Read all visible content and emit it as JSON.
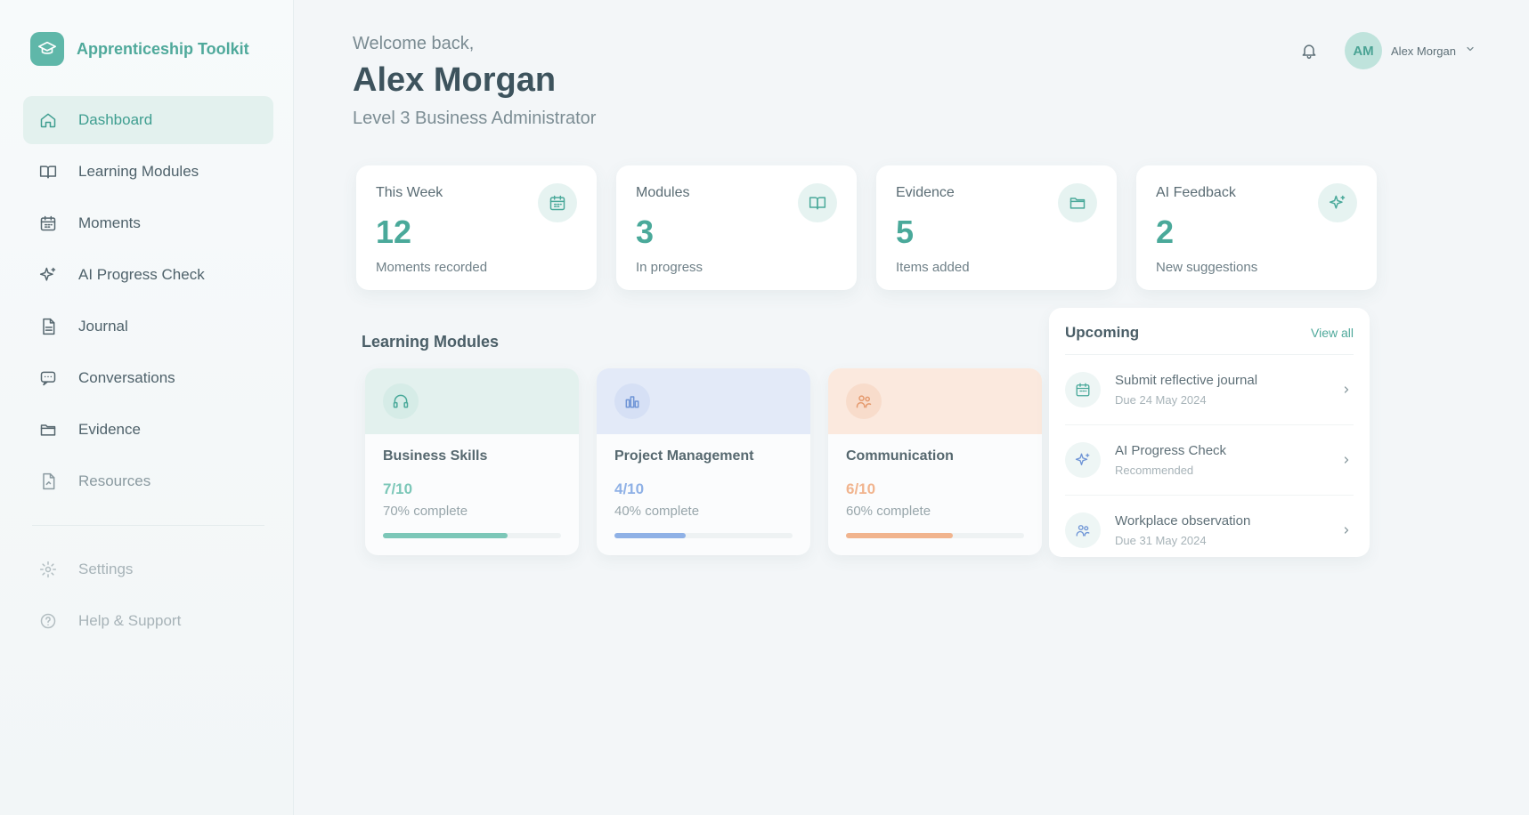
{
  "app": {
    "name": "Apprenticeship Toolkit",
    "accent": "#5fb7a9"
  },
  "sidebar": {
    "items": [
      {
        "label": "Dashboard",
        "icon": "home-icon"
      },
      {
        "label": "Learning Modules",
        "icon": "book-icon"
      },
      {
        "label": "Moments",
        "icon": "calendar-icon"
      },
      {
        "label": "AI Progress Check",
        "icon": "sparkle-icon"
      },
      {
        "label": "Journal",
        "icon": "document-icon"
      },
      {
        "label": "Conversations",
        "icon": "chat-icon"
      },
      {
        "label": "Evidence",
        "icon": "folder-icon"
      },
      {
        "label": "Resources",
        "icon": "file-icon"
      }
    ],
    "footer": [
      {
        "label": "Settings",
        "icon": "gear-icon"
      },
      {
        "label": "Help & Support",
        "icon": "help-icon"
      }
    ]
  },
  "header": {
    "welcome": "Welcome back,",
    "name": "Alex Morgan",
    "role": "Level 3 Business Administrator",
    "user": {
      "initials": "AM",
      "name": "Alex Morgan"
    }
  },
  "stats": [
    {
      "label": "This Week",
      "value": "12",
      "sub": "Moments recorded",
      "icon": "calendar-icon"
    },
    {
      "label": "Modules",
      "value": "3",
      "sub": "In progress",
      "icon": "book-icon"
    },
    {
      "label": "Evidence",
      "value": "5",
      "sub": "Items added",
      "icon": "folder-icon"
    },
    {
      "label": "AI Feedback",
      "value": "2",
      "sub": "New suggestions",
      "icon": "sparkle-icon"
    }
  ],
  "learning_modules": {
    "title": "Learning Modules",
    "items": [
      {
        "title": "Business Skills",
        "count": "7/10",
        "percent_label": "70% complete",
        "progress": 0.7,
        "color": "#7cc7b8",
        "head": "#e3f1ee",
        "icon": "headset-icon"
      },
      {
        "title": "Project Management",
        "count": "4/10",
        "percent_label": "40% complete",
        "progress": 0.4,
        "color": "#8fb1e6",
        "head": "#e3eaf8",
        "icon": "bar-chart-icon"
      },
      {
        "title": "Communication",
        "count": "6/10",
        "percent_label": "60% complete",
        "progress": 0.6,
        "color": "#f1b48e",
        "head": "#fbe9de",
        "icon": "users-icon"
      }
    ]
  },
  "upcoming": {
    "title": "Upcoming",
    "view_all": "View all",
    "items": [
      {
        "title": "Submit reflective journal",
        "sub": "Due 24 May 2024",
        "icon": "calendar-icon"
      },
      {
        "title": "AI Progress Check",
        "sub": "Recommended",
        "icon": "sparkle-icon"
      },
      {
        "title": "Workplace observation",
        "sub": "Due 31 May 2024",
        "icon": "users-icon"
      }
    ]
  }
}
